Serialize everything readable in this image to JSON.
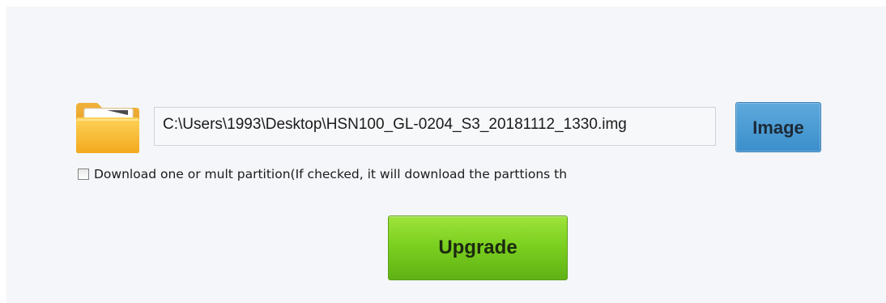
{
  "file_selector": {
    "path_value": "C:\\Users\\1993\\Desktop\\HSN100_GL-0204_S3_20181112_1330.img",
    "folder_icon": "folder-icon",
    "image_button_label": "Image"
  },
  "options": {
    "partition_checkbox_label": "Download one or mult partition(If checked, it will download the parttions th",
    "partition_checkbox_checked": false
  },
  "actions": {
    "upgrade_label": "Upgrade"
  },
  "colors": {
    "image_button": "#4a9bd4",
    "upgrade_button": "#7cd020",
    "panel_background": "#f4f6f9"
  }
}
